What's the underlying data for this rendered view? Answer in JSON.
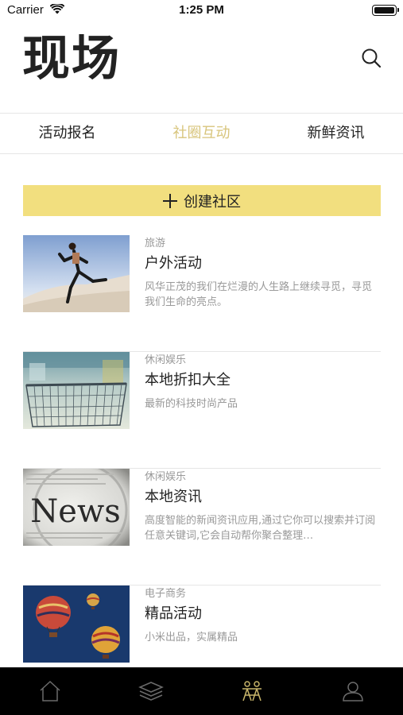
{
  "status_bar": {
    "carrier": "Carrier",
    "time": "1:25 PM"
  },
  "header": {
    "title": "现场",
    "search_icon": "search-icon"
  },
  "tabs": [
    {
      "label": "活动报名",
      "active": false
    },
    {
      "label": "社圈互动",
      "active": true
    },
    {
      "label": "新鲜资讯",
      "active": false
    }
  ],
  "create_button": {
    "label": "创建社区",
    "icon": "plus-icon"
  },
  "items": [
    {
      "category": "旅游",
      "title": "户外活动",
      "description": "风华正茂的我们在烂漫的人生路上继续寻觅，寻觅我们生命的亮点。",
      "image": "runner-photo"
    },
    {
      "category": "休闲娱乐",
      "title": "本地折扣大全",
      "description": "最新的科技时尚产品",
      "image": "shopping-cart-photo"
    },
    {
      "category": "休闲娱乐",
      "title": "本地资讯",
      "description": "高度智能的新闻资讯应用,通过它你可以搜索并订阅任意关键词,它会自动帮你聚合整理…",
      "image": "news-photo",
      "image_text": "News"
    },
    {
      "category": "电子商务",
      "title": "精品活动",
      "description": "小米出品，实属精品",
      "image": "hot-air-balloons-photo"
    }
  ],
  "tab_bar": [
    {
      "icon": "home-icon",
      "active": false
    },
    {
      "icon": "layers-icon",
      "active": false
    },
    {
      "icon": "community-icon",
      "active": true
    },
    {
      "icon": "profile-icon",
      "active": false
    }
  ],
  "colors": {
    "accent": "#d8c57c",
    "create_bg": "#f2df7f",
    "tab_bar_bg": "#000000",
    "tab_icon": "#6b6b6b",
    "tab_icon_active": "#c8b56a"
  }
}
